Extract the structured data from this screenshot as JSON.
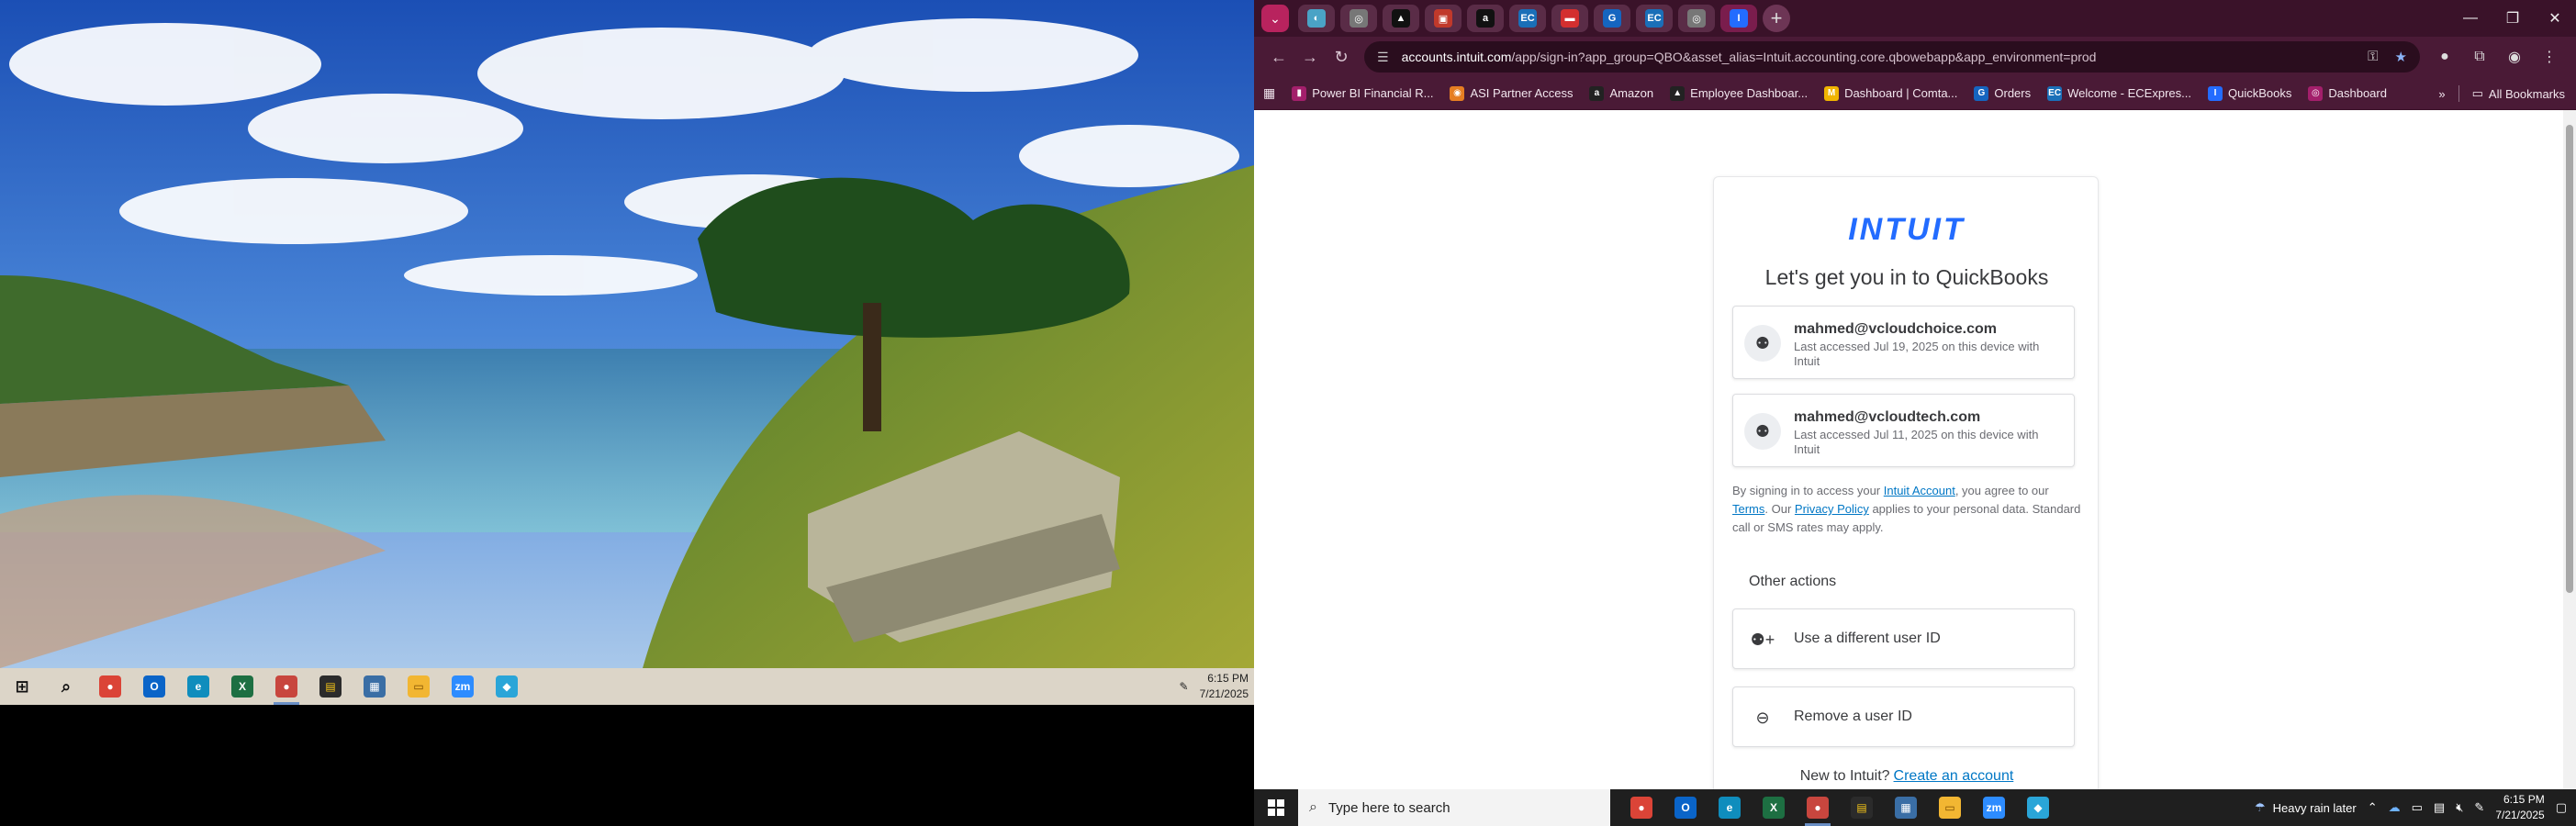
{
  "left_taskbar": {
    "clock_time": "6:15 PM",
    "clock_date": "7/21/2025",
    "apps": [
      {
        "name": "start-button",
        "glyph": "⊞",
        "color": "transparent",
        "fg": "#111"
      },
      {
        "name": "search-icon",
        "glyph": "⌕",
        "color": "transparent",
        "fg": "#111"
      },
      {
        "name": "chrome-icon",
        "glyph": "●",
        "color": "#db4437",
        "fg": "#fff"
      },
      {
        "name": "outlook-icon",
        "glyph": "O",
        "color": "#0a64c8",
        "fg": "#fff"
      },
      {
        "name": "edge-icon",
        "glyph": "e",
        "color": "#0f8dbd",
        "fg": "#fff"
      },
      {
        "name": "excel-icon",
        "glyph": "X",
        "color": "#1d6f42",
        "fg": "#fff"
      },
      {
        "name": "chrome-profile-icon",
        "glyph": "●",
        "color": "#c8463e",
        "fg": "#fff",
        "active": true
      },
      {
        "name": "sticky-notes-icon",
        "glyph": "▤",
        "color": "#2b2b2b",
        "fg": "#f5c518"
      },
      {
        "name": "calculator-icon",
        "glyph": "▦",
        "color": "#3a6ea5",
        "fg": "#fff"
      },
      {
        "name": "file-explorer-icon",
        "glyph": "▭",
        "color": "#f2b632",
        "fg": "#7a4b00"
      },
      {
        "name": "zoom-icon",
        "glyph": "zm",
        "color": "#2d8cff",
        "fg": "#fff"
      },
      {
        "name": "remote-desktop-icon",
        "glyph": "◆",
        "color": "#2aa5d8",
        "fg": "#fff"
      }
    ]
  },
  "browser": {
    "tabs": [
      {
        "name": "tab-1",
        "glyph": "◐",
        "color": "#4aa3c6"
      },
      {
        "name": "tab-2",
        "glyph": "◎",
        "color": "#777"
      },
      {
        "name": "tab-3",
        "glyph": "▲",
        "color": "#111"
      },
      {
        "name": "tab-4",
        "glyph": "▣",
        "color": "#c0392b"
      },
      {
        "name": "tab-5",
        "glyph": "a",
        "color": "#111"
      },
      {
        "name": "tab-6",
        "glyph": "EC",
        "color": "#1a6fb8"
      },
      {
        "name": "tab-7",
        "glyph": "▬",
        "color": "#d32f2f"
      },
      {
        "name": "tab-8",
        "glyph": "G",
        "color": "#1565c0"
      },
      {
        "name": "tab-9",
        "glyph": "EC",
        "color": "#1a6fb8"
      },
      {
        "name": "tab-10",
        "glyph": "◎",
        "color": "#777"
      },
      {
        "name": "tab-intuit",
        "glyph": "I",
        "color": "#236cff",
        "active": true
      }
    ],
    "url_host": "accounts.intuit.com",
    "url_path": "/app/sign-in?app_group=QBO&asset_alias=Intuit.accounting.core.qbowebapp&app_environment=prod",
    "bookmarks": [
      {
        "label": "Power BI Financial R...",
        "glyph": "▮",
        "color": "#a31f6b"
      },
      {
        "label": "ASI Partner Access",
        "glyph": "◉",
        "color": "#e67e22"
      },
      {
        "label": "Amazon",
        "glyph": "a",
        "color": "#222"
      },
      {
        "label": "Employee Dashboar...",
        "glyph": "▲",
        "color": "#222"
      },
      {
        "label": "Dashboard | Comta...",
        "glyph": "M",
        "color": "#f0b400"
      },
      {
        "label": "Orders",
        "glyph": "G",
        "color": "#1565c0"
      },
      {
        "label": "Welcome - ECExpres...",
        "glyph": "EC",
        "color": "#1a6fb8"
      },
      {
        "label": "QuickBooks",
        "glyph": "I",
        "color": "#236cff"
      },
      {
        "label": "Dashboard",
        "glyph": "◎",
        "color": "#a31f6b"
      }
    ],
    "all_bookmarks_label": "All Bookmarks"
  },
  "signin": {
    "logo": "INTUIT",
    "title": "Let's get you in to QuickBooks",
    "accounts": [
      {
        "email": "mahmed@vcloudchoice.com",
        "meta": "Last accessed Jul 19, 2025 on this device with Intuit"
      },
      {
        "email": "mahmed@vcloudtech.com",
        "meta": "Last accessed Jul 11, 2025 on this device with Intuit"
      }
    ],
    "legal": {
      "p1": "By signing in to access your ",
      "link_account": "Intuit Account",
      "p2": ", you agree to our ",
      "link_terms": "Terms",
      "p3": ". Our ",
      "link_privacy": "Privacy Policy",
      "p4": " applies to your personal data. Standard call or SMS rates may apply."
    },
    "other_actions_label": "Other actions",
    "actions": [
      {
        "label": "Use a different user ID",
        "icon": "add-user-icon"
      },
      {
        "label": "Remove a user ID",
        "icon": "minus-circle-icon"
      }
    ],
    "new_to": "New to Intuit?",
    "create_account": "Create an account"
  },
  "right_taskbar": {
    "search_placeholder": "Type here to search",
    "weather": "Heavy rain later",
    "clock_time": "6:15 PM",
    "clock_date": "7/21/2025",
    "apps": [
      {
        "name": "chrome-icon",
        "glyph": "●",
        "color": "#db4437",
        "fg": "#fff"
      },
      {
        "name": "outlook-icon",
        "glyph": "O",
        "color": "#0a64c8",
        "fg": "#fff"
      },
      {
        "name": "edge-icon",
        "glyph": "e",
        "color": "#0f8dbd",
        "fg": "#fff"
      },
      {
        "name": "excel-icon",
        "glyph": "X",
        "color": "#1d6f42",
        "fg": "#fff"
      },
      {
        "name": "chrome-profile-icon",
        "glyph": "●",
        "color": "#c8463e",
        "fg": "#fff",
        "active": true
      },
      {
        "name": "sticky-notes-icon",
        "glyph": "▤",
        "color": "#2b2b2b",
        "fg": "#f5c518"
      },
      {
        "name": "calculator-icon",
        "glyph": "▦",
        "color": "#3a6ea5",
        "fg": "#fff"
      },
      {
        "name": "file-explorer-icon",
        "glyph": "▭",
        "color": "#f2b632",
        "fg": "#7a4b00"
      },
      {
        "name": "zoom-icon",
        "glyph": "zm",
        "color": "#2d8cff",
        "fg": "#fff"
      },
      {
        "name": "remote-desktop-icon",
        "glyph": "◆",
        "color": "#2aa5d8",
        "fg": "#fff"
      }
    ]
  }
}
